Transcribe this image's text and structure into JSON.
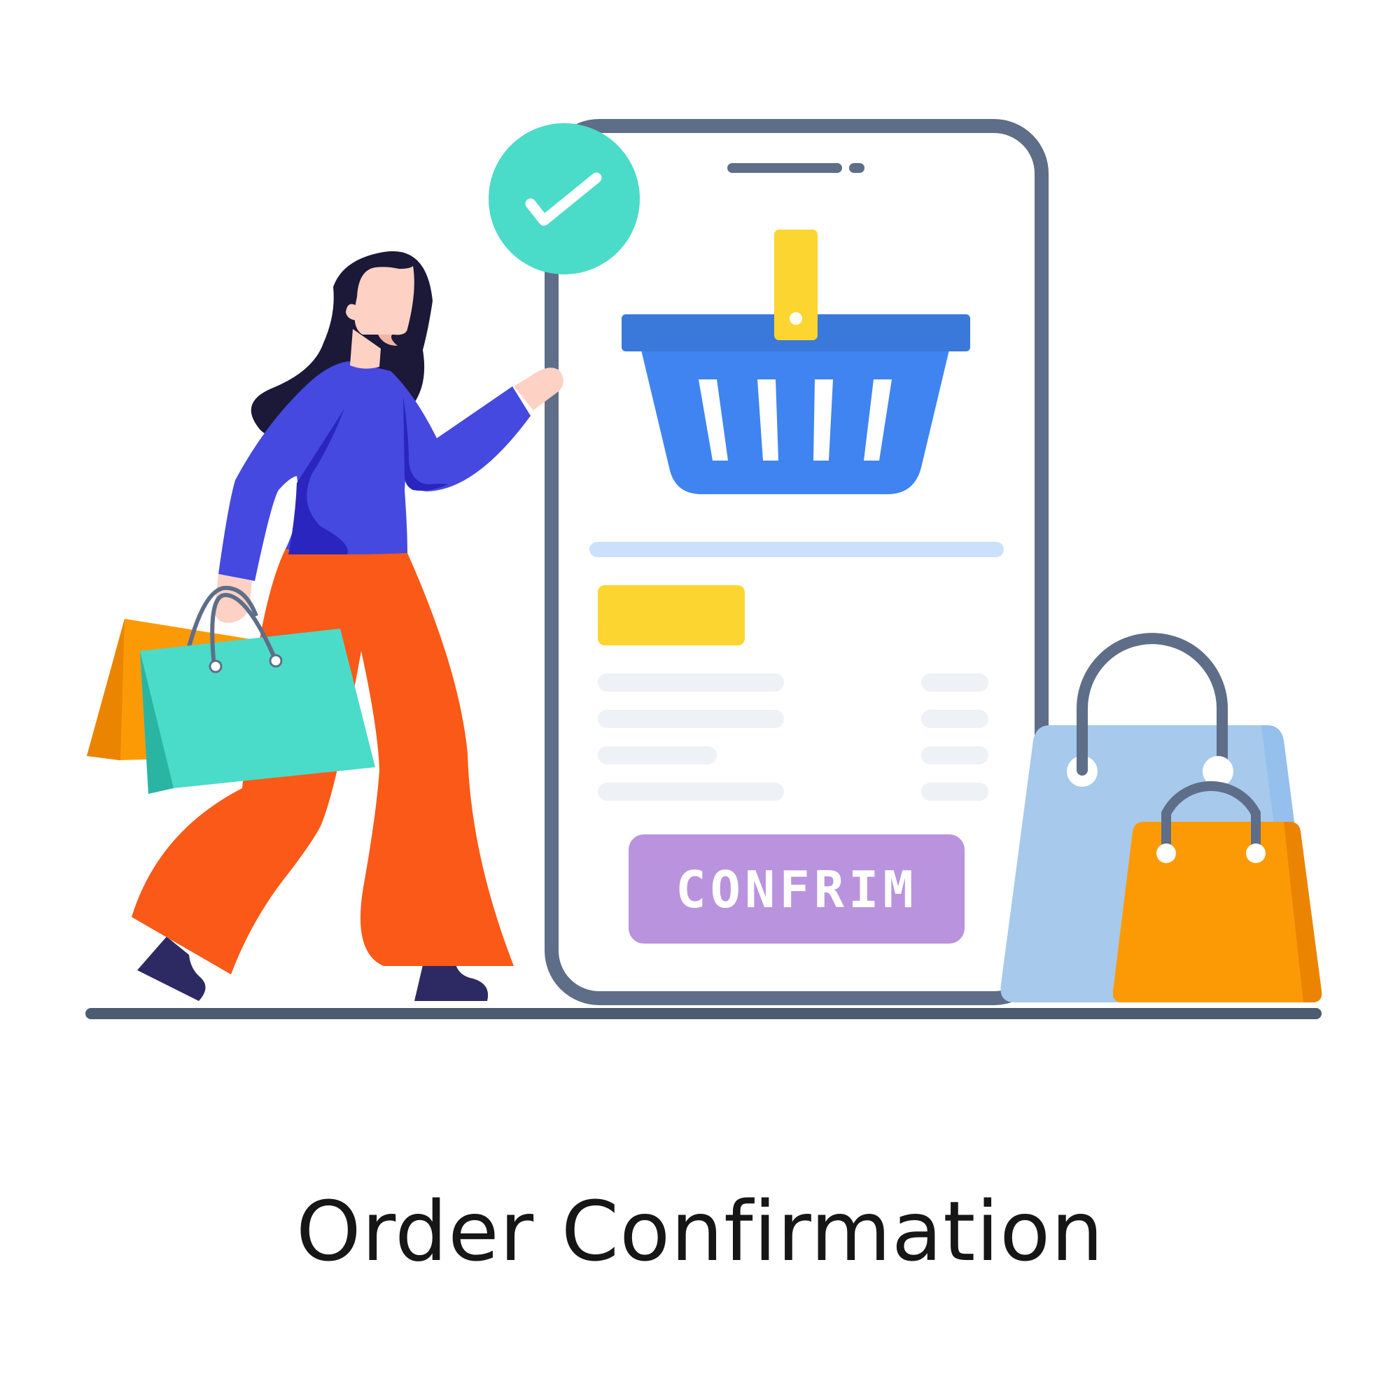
{
  "caption": "Order Confirmation",
  "phone": {
    "confirm_button_label": "CONFRIM"
  },
  "icons": {
    "check": "check-icon",
    "basket": "shopping-basket-icon",
    "bag": "shopping-bag-icon"
  },
  "colors": {
    "phone_frame": "#5E6E89",
    "check_badge": "#4ADCC8",
    "basket": "#3F84F0",
    "basket_rim": "#3A79DA",
    "basket_tag": "#FCD530",
    "confirm_button": "#B993DE",
    "skin": "#FDD1C3",
    "shirt": "#4549E0",
    "pants": "#FA5918",
    "bag_teal": "#4ADCC8",
    "bag_orange": "#FC9A05",
    "bag_blue": "#A6C9EC"
  }
}
